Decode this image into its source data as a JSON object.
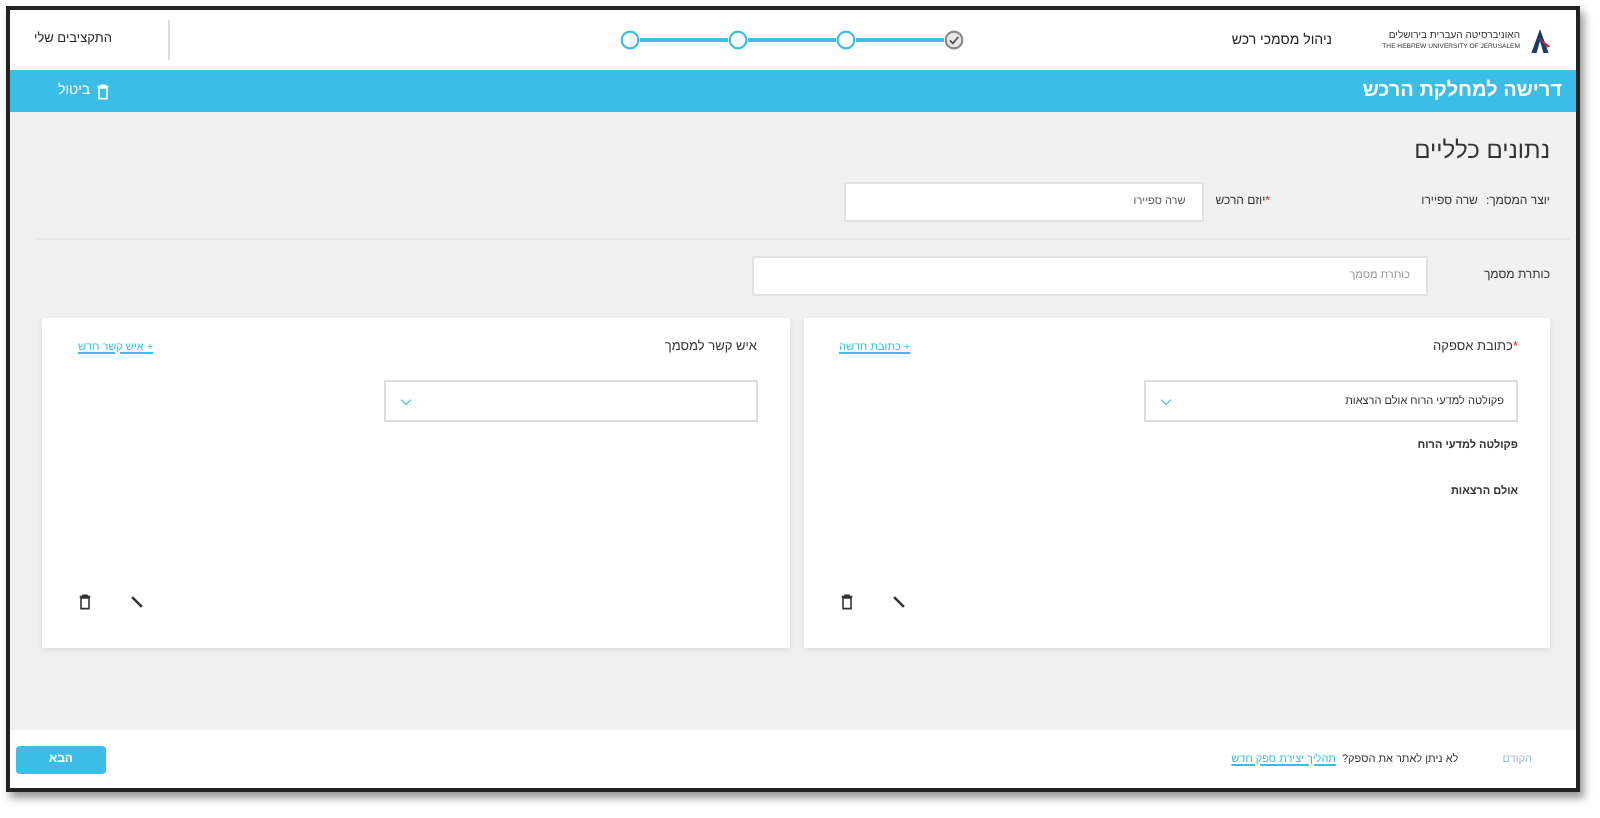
{
  "header": {
    "logo_hebrew": "האוניברסיטה העברית בירושלים",
    "logo_english": "THE HEBREW UNIVERSITY OF JERUSALEM",
    "app_title": "ניהול מסמכי רכש",
    "my_budgets": "התקציבים שלי"
  },
  "stepper": [
    {
      "done": true
    },
    {
      "done": false
    },
    {
      "done": false
    },
    {
      "done": false
    }
  ],
  "title_bar": {
    "title": "דרישה למחלקת הרכש",
    "cancel": "ביטול"
  },
  "section_title": "נתונים כלליים",
  "creator": {
    "label": "יוצר המסמך:",
    "value": "שרה ספיירו"
  },
  "initiator": {
    "required_mark": "*",
    "label": "יוזם הרכש",
    "value": "שרה ספיירו"
  },
  "doc_title": {
    "label": "כותרת מסמך",
    "placeholder": "כותרת מסמך"
  },
  "cards": [
    {
      "required_mark": "*",
      "label": "כתובת אספקה",
      "link": "+ כתובת חדשה",
      "select_value": "פקולטה למדעי הרוח אולם הרצאות",
      "lines": [
        "פקולטה למדעי הרוח",
        "אולם הרצאות"
      ]
    },
    {
      "label": "איש קשר למסמך",
      "link": "+ איש קשר חדש"
    }
  ],
  "footer": {
    "previous": {
      "label": "הקודם",
      "disabled": true
    },
    "question": "לא ניתן לאתר את הספק?",
    "link": "תהליך יצירת ספק חדש",
    "next": "הבא"
  }
}
